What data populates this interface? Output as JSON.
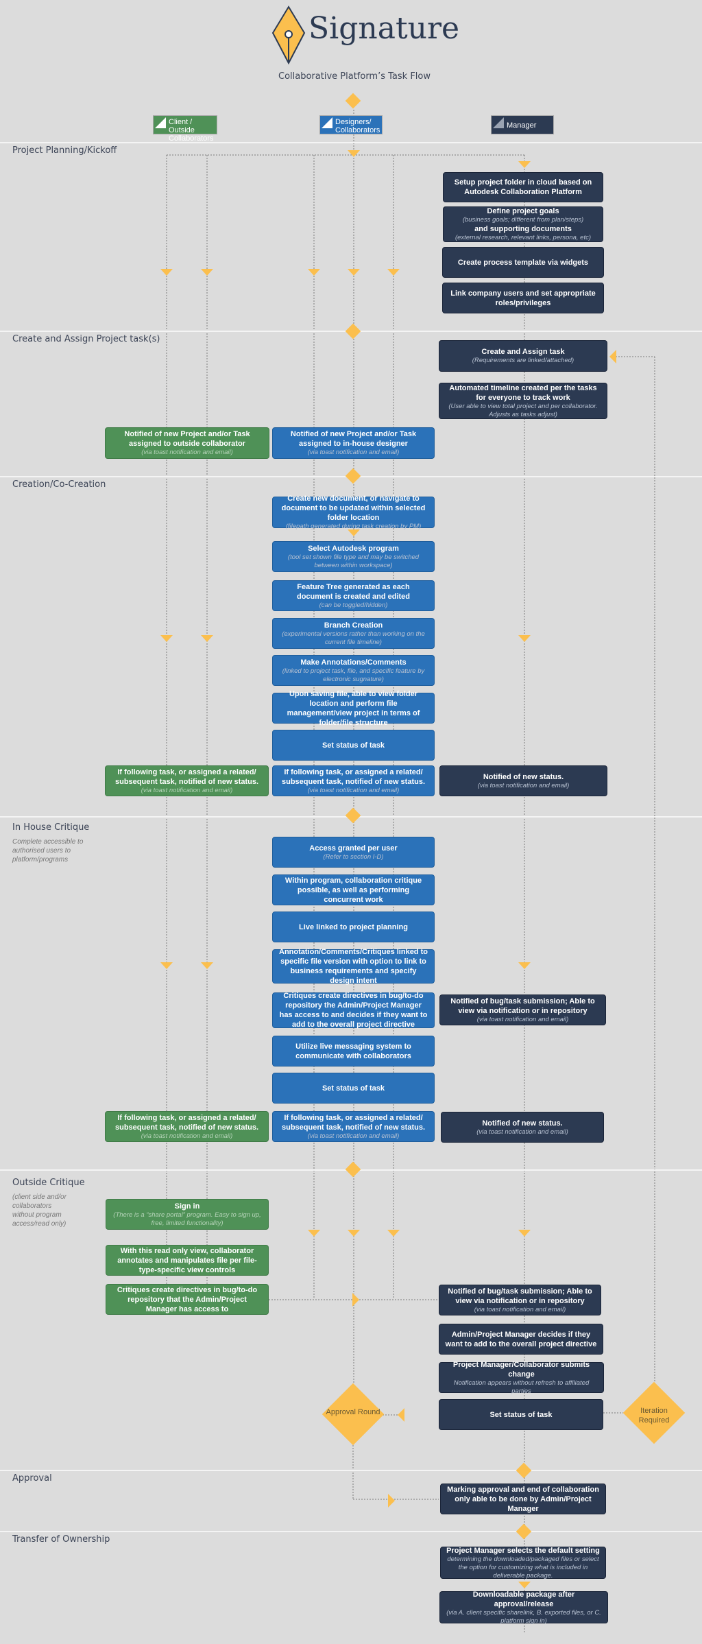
{
  "header": {
    "logo_text": "Signature",
    "subtitle": "Collaborative Platform’s Task Flow"
  },
  "legend": [
    {
      "label": "Client / Outside Collaborators",
      "color": "#4f9157"
    },
    {
      "label": "Designers/ Collaborators",
      "color": "#2b72b9"
    },
    {
      "label": "Manager",
      "color": "#2c3a52"
    }
  ],
  "colors": {
    "accent": "#fbbf4e",
    "client": "#4f9157",
    "designer": "#2b72b9",
    "manager": "#2c3a52",
    "background": "#dcdcdc"
  },
  "sections": [
    {
      "title": "Project Planning/Kickoff"
    },
    {
      "title": "Create and Assign Project task(s)"
    },
    {
      "title": "Creation/Co-Creation"
    },
    {
      "title": "In House Critique",
      "note": "Complete accessible to authorised users to platform/programs"
    },
    {
      "title": "Outside Critique",
      "note": "(client side and/or collaborators without program access/read only)"
    },
    {
      "title": "Approval"
    },
    {
      "title": "Transfer of Ownership"
    }
  ],
  "boxes": {
    "setup_folder": {
      "title": "Setup project folder in cloud based on Autodesk Collaboration Platform"
    },
    "define_goals": {
      "title": "Define project goals",
      "sub": "(business goals; different from plan/steps)",
      "title2": "and supporting documents",
      "sub2": "(external research, relevant links, persona, etc)"
    },
    "process_template": {
      "title": "Create process template via widgets"
    },
    "link_users": {
      "title": "Link company users and set appropriate roles/privileges"
    },
    "create_assign": {
      "title": "Create and Assign task",
      "sub": "(Requirements are linked/attached)"
    },
    "timeline": {
      "title": "Automated timeline created per the tasks for everyone to track work",
      "sub": "(User able to view total project and per collaborator. Adjusts as tasks adjust)"
    },
    "notified_outside": {
      "title": "Notified of new Project and/or Task assigned to outside collaborator",
      "sub": "(via toast notification and email)"
    },
    "notified_inhouse": {
      "title": "Notified of new Project and/or Task assigned to in-house designer",
      "sub": "(via toast notification and email)"
    },
    "create_doc": {
      "title": "Create new document, or navigate to document to be updated within selected folder location",
      "sub": "(filepath generated during task creation by PM)"
    },
    "select_program": {
      "title": "Select Autodesk program",
      "sub": "(tool set shown file type and may be switched between within workspace)"
    },
    "feature_tree": {
      "title": "Feature Tree generated as each document is created and edited",
      "sub": "(can be toggled/hidden)"
    },
    "branch": {
      "title": "Branch Creation",
      "sub": "(experimental versions rather than working on the current file timeline)"
    },
    "annotations": {
      "title": "Make Annotations/Comments",
      "sub": "(linked to project task, file, and specific feature by electronic sugnature)"
    },
    "saving": {
      "title": "Upon saving file, able to view folder location and perform file management/view project in terms of folder/file structure"
    },
    "status1": {
      "title": "Set status of task"
    },
    "follow_green1": {
      "title": "If following task, or assigned a related/ subsequent task, notified of new status.",
      "sub": "(via toast notification and email)"
    },
    "follow_blue1": {
      "title": "If following task, or assigned a related/ subsequent task, notified of new status.",
      "sub": "(via toast notification and email)"
    },
    "notified_status1": {
      "title": "Notified of new status.",
      "sub": "(via toast notification and email)"
    },
    "access": {
      "title": "Access granted per user",
      "sub": "(Refer to section I-D)"
    },
    "within_program": {
      "title": "Within program, collaboration critique possible, as well as performing concurrent work"
    },
    "live_linked": {
      "title": "Live linked to project planning"
    },
    "annot_critiques": {
      "title": "Annotation/Comments/Critiques linked to specific file version with option to link to business requirements and specify design intent"
    },
    "critiques_directives": {
      "title": "Critiques create directives in bug/to-do repository the Admin/Project Manager has access to and decides if they want to add to the overall project directive"
    },
    "notified_bug1": {
      "title": "Notified of bug/task submission; Able to view via notification or in repository",
      "sub": "(via toast notification and email)"
    },
    "live_messaging": {
      "title": "Utilize live messaging system to communicate with collaborators"
    },
    "status2": {
      "title": "Set status of task"
    },
    "follow_green2": {
      "title": "If following task, or assigned a related/ subsequent task, notified of new status.",
      "sub": "(via toast notification and email)"
    },
    "follow_blue2": {
      "title": "If following task, or assigned a related/ subsequent task, notified of new status.",
      "sub": "(via toast notification and email)"
    },
    "notified_status2": {
      "title": "Notified of new status.",
      "sub": "(via toast notification and email)"
    },
    "sign_in": {
      "title": "Sign in",
      "sub": "(There is a “share portal” program. Easy to sign up, free, limited functionality)"
    },
    "read_only": {
      "title": "With this read only view, collaborator annotates and manipulates file per file-type-specific view controls"
    },
    "outside_directives": {
      "title": "Critiques create directives in bug/to-do repository that the Admin/Project Manager has access to"
    },
    "notified_bug2": {
      "title": "Notified of bug/task submission; Able to view via notification or in repository",
      "sub": "(via toast notification and email)"
    },
    "pm_decides": {
      "title": "Admin/Project Manager decides if they want to add to the overall project directive"
    },
    "submits_change": {
      "title": "Project Manager/Collaborator submits change",
      "sub": "Notification appears without refresh to affiliated parties"
    },
    "status3": {
      "title": "Set status of task"
    },
    "marking_approval": {
      "title": "Marking approval and end of collaboration only able to be done by Admin/Project Manager"
    },
    "default_setting": {
      "title": "Project Manager selects the default setting",
      "sub": "determining the downloaded/packaged files or select the option for customizing what is included in deliverable package."
    },
    "download_package": {
      "title": "Downloadable package after approval/release",
      "sub": "(via A. client specific sharelink, B. exported files, or  C. platform sign in)"
    }
  },
  "decisions": {
    "approval_round": "Approval Round",
    "iteration_required": "Iteration Required"
  }
}
